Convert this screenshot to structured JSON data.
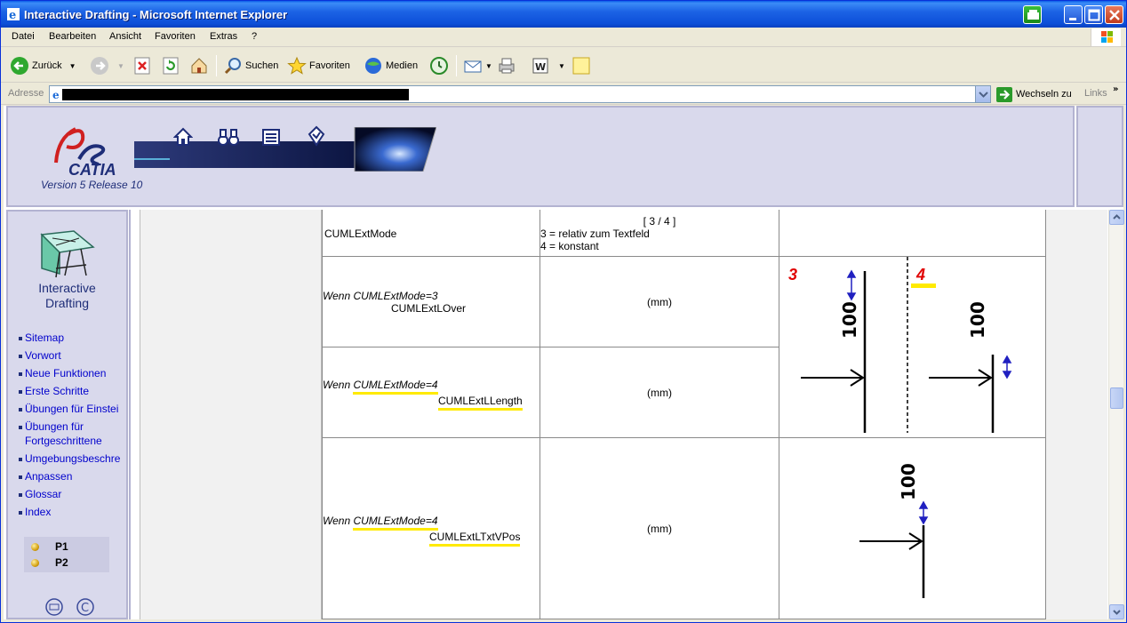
{
  "window": {
    "title": "Interactive Drafting - Microsoft Internet Explorer"
  },
  "menu": {
    "items": [
      "Datei",
      "Bearbeiten",
      "Ansicht",
      "Favoriten",
      "Extras",
      "?"
    ]
  },
  "toolbar": {
    "back_label": "Zurück",
    "search_label": "Suchen",
    "favorites_label": "Favoriten",
    "media_label": "Medien"
  },
  "address": {
    "label": "Adresse",
    "go_label": "Wechseln zu",
    "links_label": "Links"
  },
  "header": {
    "logo_text": "CATIA",
    "version": "Version 5 Release 10"
  },
  "nav": {
    "title_line1": "Interactive",
    "title_line2": "Drafting",
    "links": [
      {
        "label": "Sitemap"
      },
      {
        "label": "Vorwort"
      },
      {
        "label": "Neue Funktionen"
      },
      {
        "label": "Erste Schritte"
      },
      {
        "label": "Übungen für Einstei"
      },
      {
        "label": "Übungen für",
        "label2": "Fortgeschrittene"
      },
      {
        "label": "Umgebungsbeschre"
      },
      {
        "label": "Anpassen"
      },
      {
        "label": "Glossar"
      },
      {
        "label": "Index"
      }
    ],
    "p1": "P1",
    "p2": "P2"
  },
  "table": {
    "row1": {
      "name": "CUMLExtMode",
      "value_line1": "[ 3 / 4 ]",
      "value_line2": "3 = relativ zum Textfeld",
      "value_line3": "4 = konstant"
    },
    "row2": {
      "cond": "Wenn CUMLExtMode=3",
      "name": "CUMLExtLOver",
      "unit": "(mm)"
    },
    "row3": {
      "cond_prefix": "Wenn ",
      "cond_hl": "CUMLExtMode=4",
      "name": "CUMLExtLLength",
      "unit": "(mm)"
    },
    "row4": {
      "cond_prefix": "Wenn ",
      "cond_hl": "CUMLExtMode=4",
      "name": "CUMLExtLTxtVPos",
      "unit": "(mm)"
    }
  },
  "figures": {
    "fig1_label_left": "3",
    "fig1_label_right": "4",
    "dim_text": "100"
  },
  "colors": {
    "title_bar": "#0d4fd8",
    "highlight": "#ffea00",
    "mode_label": "#e00000",
    "nav_bg": "#d9d9ec"
  }
}
